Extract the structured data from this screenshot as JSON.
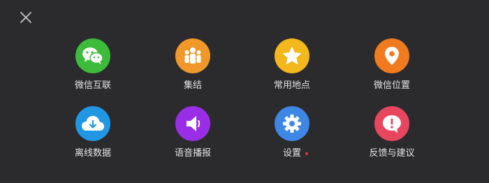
{
  "close": {
    "icon": "close-icon"
  },
  "colors": {
    "background": "#2b2b2d",
    "wechat": "#3dbb3a",
    "gather": "#f0992a",
    "places": "#f2b81c",
    "location": "#f07a1e",
    "offline": "#2196e3",
    "voice": "#9a2ee6",
    "settings": "#3e87e5",
    "feedback": "#e8465f",
    "badge": "#e13a3a"
  },
  "menu": [
    {
      "label": "微信互联",
      "icon": "wechat-icon"
    },
    {
      "label": "集结",
      "icon": "group-icon"
    },
    {
      "label": "常用地点",
      "icon": "star-icon"
    },
    {
      "label": "微信位置",
      "icon": "location-pin-icon"
    },
    {
      "label": "离线数据",
      "icon": "cloud-download-icon"
    },
    {
      "label": "语音播报",
      "icon": "speaker-icon"
    },
    {
      "label": "设置",
      "icon": "gear-icon",
      "badge": true
    },
    {
      "label": "反馈与建议",
      "icon": "feedback-icon"
    }
  ]
}
